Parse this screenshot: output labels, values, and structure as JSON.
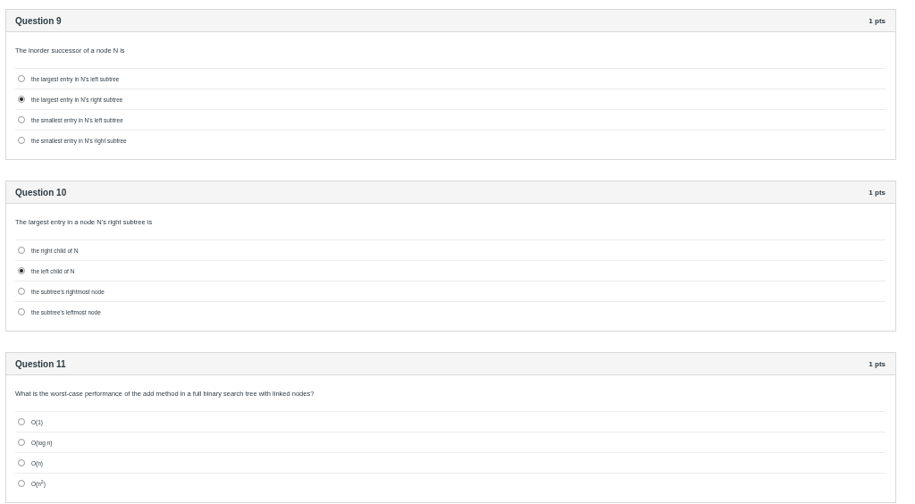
{
  "questions": [
    {
      "title": "Question 9",
      "points": "1 pts",
      "text": "The inorder successor of a node N is",
      "options": [
        {
          "label": "the largest entry in N's left subtree",
          "selected": false
        },
        {
          "label": "the largest entry in N's right subtree",
          "selected": true
        },
        {
          "label": "the smallest entry in N's left subtree",
          "selected": false
        },
        {
          "label": "the smallest entry in N's right subtree",
          "selected": false
        }
      ]
    },
    {
      "title": "Question 10",
      "points": "1 pts",
      "text": "The largest entry in a node N's right subtree is",
      "options": [
        {
          "label": "the right child of N",
          "selected": false
        },
        {
          "label": "the left child of N",
          "selected": true
        },
        {
          "label": "the subtree's rightmost node",
          "selected": false
        },
        {
          "label": "the subtree's leftmost node",
          "selected": false
        }
      ]
    },
    {
      "title": "Question 11",
      "points": "1 pts",
      "text": "What is the worst-case performance of the add method in a full binary search tree with linked nodes?",
      "options": [
        {
          "label": "O(1)",
          "selected": false
        },
        {
          "label": "O(log n)",
          "selected": false
        },
        {
          "label": "O(n)",
          "selected": false
        },
        {
          "label": "O(n$^{2}$)",
          "selected": false
        }
      ]
    }
  ]
}
